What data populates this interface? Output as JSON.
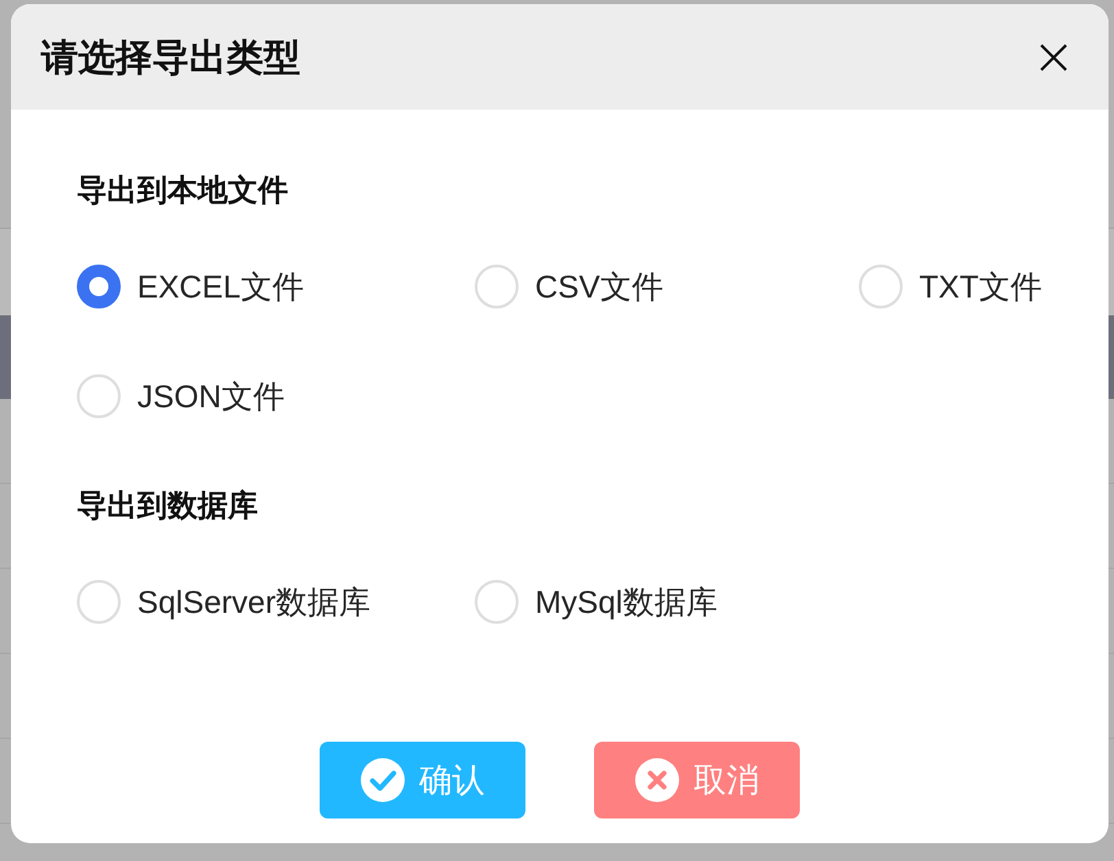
{
  "dialog": {
    "title": "请选择导出类型"
  },
  "sections": [
    {
      "heading": "导出到本地文件",
      "options": [
        {
          "label": "EXCEL文件",
          "selected": true
        },
        {
          "label": "CSV文件",
          "selected": false
        },
        {
          "label": "TXT文件",
          "selected": false
        },
        {
          "label": "JSON文件",
          "selected": false
        }
      ]
    },
    {
      "heading": "导出到数据库",
      "options": [
        {
          "label": "SqlServer数据库",
          "selected": false
        },
        {
          "label": "MySql数据库",
          "selected": false
        }
      ]
    }
  ],
  "buttons": [
    {
      "label": "确认",
      "kind": "confirm"
    },
    {
      "label": "取消",
      "kind": "cancel"
    }
  ]
}
